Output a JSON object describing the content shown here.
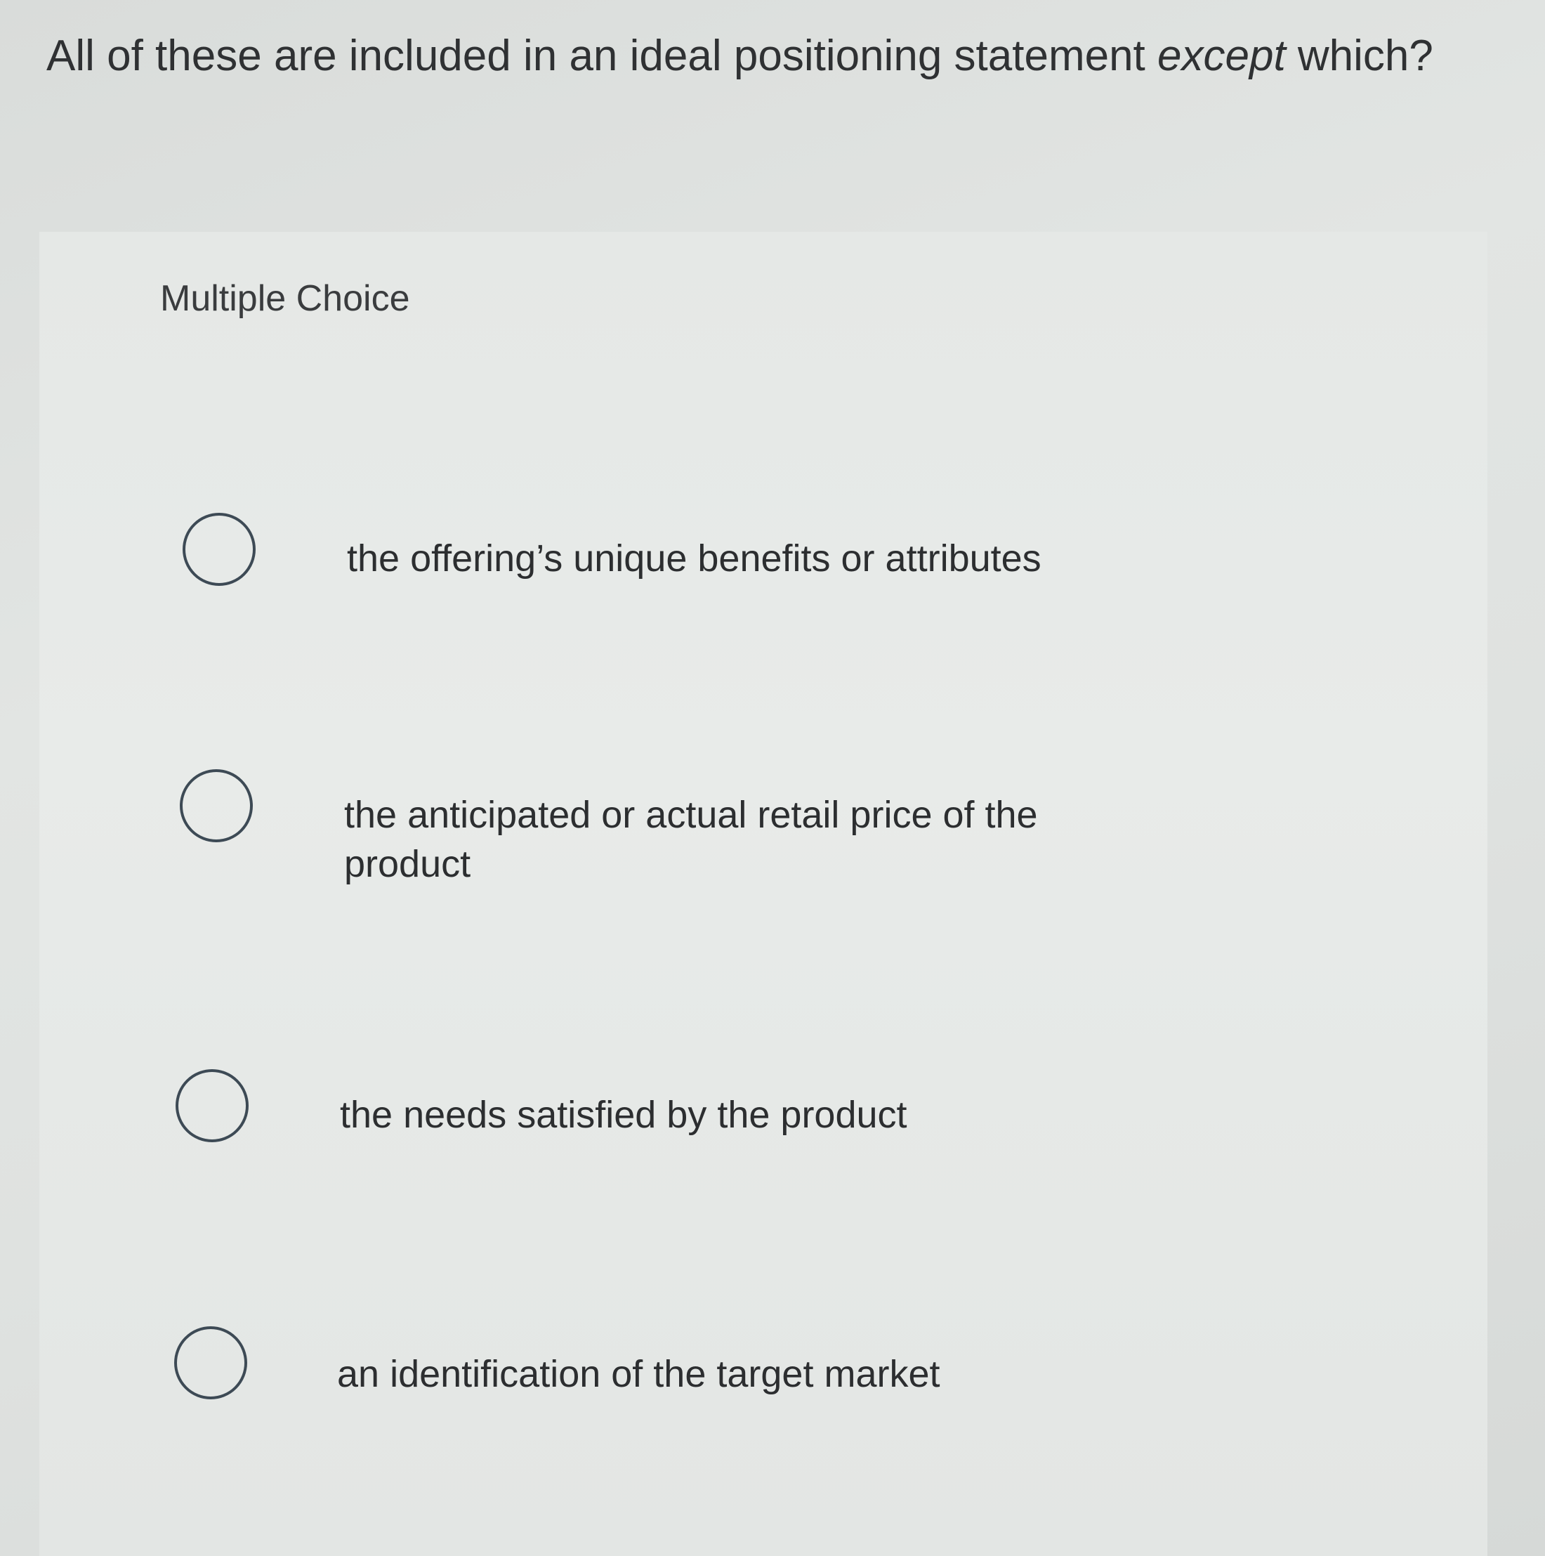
{
  "question": {
    "text_before": "All of these are included in an ideal positioning statement ",
    "emphasis": "except",
    "text_after": " which?"
  },
  "section_label": "Multiple Choice",
  "options": [
    {
      "label": "the offering’s unique benefits or attributes"
    },
    {
      "label": "the anticipated or actual retail price of the product"
    },
    {
      "label": "the needs satisfied by the product"
    },
    {
      "label": "an identification of the target market"
    }
  ],
  "colors": {
    "radio_border": "#3d4a55",
    "text": "#2c2e30"
  }
}
